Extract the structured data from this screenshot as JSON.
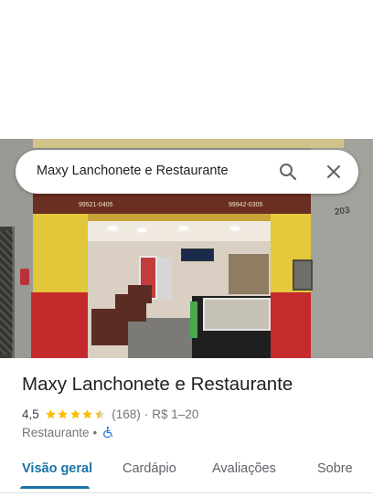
{
  "search": {
    "query": "Maxy Lanchonete e Restaurante"
  },
  "place": {
    "name": "Maxy Lanchonete e Restaurante",
    "rating": "4,5",
    "rating_value": 4.5,
    "rating_max": 5,
    "review_count": "(168)",
    "separator": "·",
    "price_range": "R$ 1–20",
    "category": "Restaurante",
    "category_separator": "•",
    "accessibility_icon": "wheelchair-accessible-icon"
  },
  "photo": {
    "sign_phone_left": "99521-0405",
    "sign_phone_right": "99942-0305",
    "building_number": "203"
  },
  "tabs": [
    {
      "label": "Visão geral",
      "active": true
    },
    {
      "label": "Cardápio",
      "active": false
    },
    {
      "label": "Avaliações",
      "active": false
    },
    {
      "label": "Sobre",
      "active": false
    }
  ],
  "colors": {
    "accent": "#1a73a6",
    "star": "#fbbc04",
    "text_primary": "#202124",
    "text_secondary": "#70757a"
  }
}
